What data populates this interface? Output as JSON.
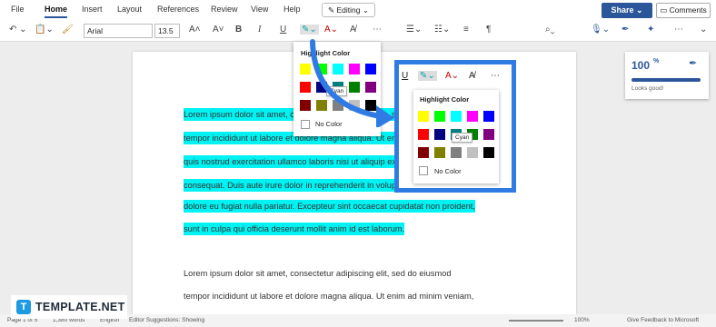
{
  "menu": {
    "tabs": [
      "File",
      "Home",
      "Insert",
      "Layout",
      "References",
      "Review",
      "View",
      "Help"
    ],
    "active": "Home",
    "editing_label": "Editing",
    "share_label": "Share",
    "comments_label": "Comments"
  },
  "toolbar": {
    "font_name": "Arial",
    "font_size": "13.5"
  },
  "document": {
    "highlighted_lines": [
      "Lorem ipsum dolor sit amet, consectetur adipiscing elit, sed do eiusmod",
      "tempor incididunt ut labore et dolore magna aliqua. Ut enim ad minim veniam,",
      "quis nostrud exercitation ullamco laboris nisi ut aliquip ex ea commodo",
      "consequat. Duis aute irure dolor in reprehenderit in voluptate velit esse",
      "dolore eu fugiat nulla pariatur. Excepteur sint occaecat cupidatat non proident,",
      "sunt in culpa qui officia deserunt mollit anim id est laborum."
    ],
    "plain_lines": [
      "Lorem ipsum dolor sit amet, consectetur adipiscing elit, sed do eiusmod",
      "tempor incididunt ut labore et dolore magna aliqua. Ut enim ad minim veniam,"
    ]
  },
  "highlight_menu": {
    "title": "Highlight Color",
    "no_color": "No Color",
    "tooltip": "Cyan",
    "swatches": [
      "#ffff00",
      "#00ff00",
      "#00ffff",
      "#ff00ff",
      "#0000ff",
      "#ff0000",
      "#000080",
      "#008080",
      "#008000",
      "#800080",
      "#800000",
      "#808000",
      "#808080",
      "#c0c0c0",
      "#000000"
    ]
  },
  "score_card": {
    "value": "100",
    "unit": "%",
    "caption": "Looks good!"
  },
  "statusbar": {
    "page": "Page 1 of 5",
    "words": "1,380 words",
    "language": "English",
    "suggestions": "Editor Suggestions: Showing",
    "zoom": "100%",
    "feedback": "Give Feedback to Microsoft"
  },
  "branding": {
    "logo_letter": "T",
    "logo_text": "TEMPLATE.NET"
  },
  "colors": {
    "accent": "#2b579a",
    "callout_border": "#2f7be3",
    "highlight": "#00f2f2"
  }
}
